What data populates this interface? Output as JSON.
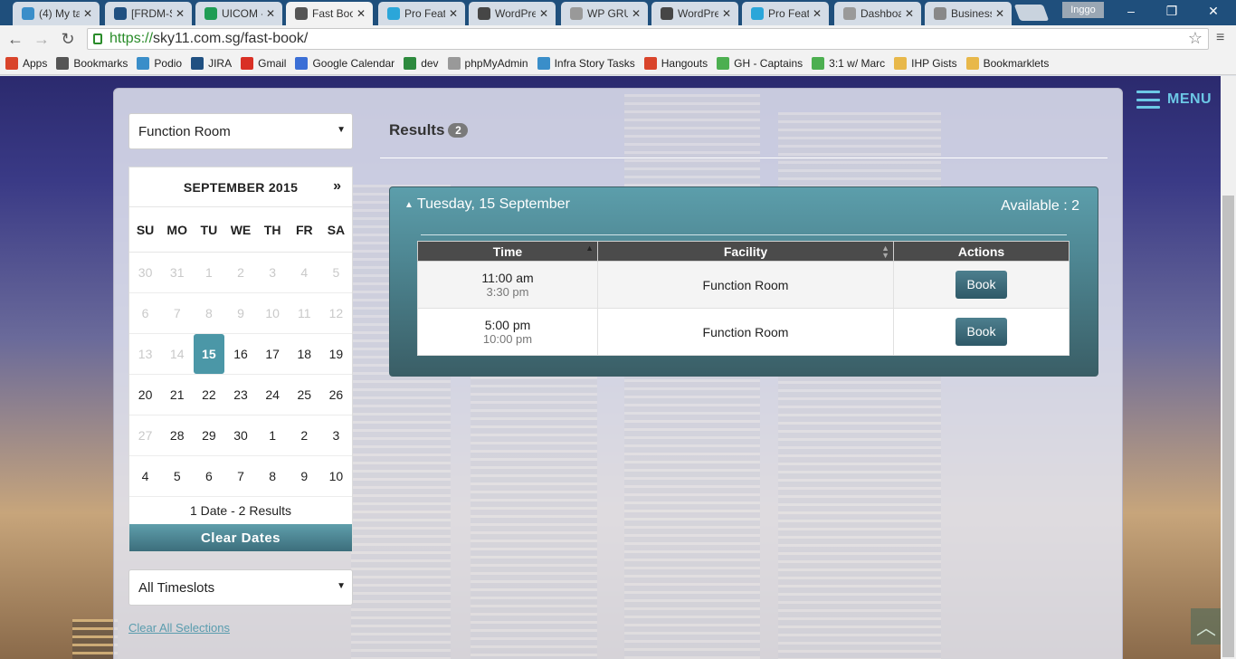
{
  "browser": {
    "tabs": [
      {
        "title": "(4) My ta",
        "icon": "podio-icon",
        "color": "#3a8ec9"
      },
      {
        "title": "[FRDM-S",
        "icon": "jira-icon",
        "color": "#205081"
      },
      {
        "title": "UICOM -",
        "icon": "sheets-icon",
        "color": "#1f9d55"
      },
      {
        "title": "Fast Boo",
        "icon": "site-icon",
        "color": "#555555"
      },
      {
        "title": "Pro Featu",
        "icon": "elementor-icon",
        "color": "#2ba6d9"
      },
      {
        "title": "WordPre",
        "icon": "wordpress-icon",
        "color": "#464646"
      },
      {
        "title": "WP GRU",
        "icon": "page-icon",
        "color": "#999999"
      },
      {
        "title": "WordPre",
        "icon": "wordpress-icon",
        "color": "#464646"
      },
      {
        "title": "Pro Featu",
        "icon": "elementor-icon",
        "color": "#2ba6d9"
      },
      {
        "title": "Dashboa",
        "icon": "page-icon",
        "color": "#999999"
      },
      {
        "title": "Business",
        "icon": "wp-icon",
        "color": "#888888"
      }
    ],
    "user": "Inggo",
    "url_scheme": "https://",
    "url_host_path": "sky11.com.sg/fast-book/",
    "bookmarks": [
      {
        "label": "Apps",
        "icon": "apps-grid-icon",
        "color": "#d9442b"
      },
      {
        "label": "Bookmarks",
        "icon": "star-icon",
        "color": "#555555"
      },
      {
        "label": "Podio",
        "icon": "podio-icon",
        "color": "#3a8ec9"
      },
      {
        "label": "JIRA",
        "icon": "jira-icon",
        "color": "#205081"
      },
      {
        "label": "Gmail",
        "icon": "gmail-icon",
        "color": "#d93025"
      },
      {
        "label": "Google Calendar",
        "icon": "calendar-icon",
        "color": "#3b6fd6"
      },
      {
        "label": "dev",
        "icon": "leaf-icon",
        "color": "#2d8a3e"
      },
      {
        "label": "phpMyAdmin",
        "icon": "page-icon",
        "color": "#999999"
      },
      {
        "label": "Infra Story Tasks",
        "icon": "podio-icon",
        "color": "#3a8ec9"
      },
      {
        "label": "Hangouts",
        "icon": "gplus-icon",
        "color": "#d9442b"
      },
      {
        "label": "GH - Captains",
        "icon": "evernote-icon",
        "color": "#4caf50"
      },
      {
        "label": "3:1 w/ Marc",
        "icon": "evernote-icon",
        "color": "#4caf50"
      },
      {
        "label": "IHP Gists",
        "icon": "folder-icon",
        "color": "#e8b84a"
      },
      {
        "label": "Bookmarklets",
        "icon": "folder-icon",
        "color": "#e8b84a"
      }
    ]
  },
  "site": {
    "menu_label": "MENU",
    "facility_select": "Function Room",
    "timeslot_select": "All Timeslots",
    "clear_all": "Clear All Selections",
    "calendar": {
      "month_label": "SEPTEMBER 2015",
      "next_label": "»",
      "days_of_week": [
        "SU",
        "MO",
        "TU",
        "WE",
        "TH",
        "FR",
        "SA"
      ],
      "weeks": [
        [
          {
            "d": "30",
            "dim": true
          },
          {
            "d": "31",
            "dim": true
          },
          {
            "d": "1",
            "dim": true
          },
          {
            "d": "2",
            "dim": true
          },
          {
            "d": "3",
            "dim": true
          },
          {
            "d": "4",
            "dim": true
          },
          {
            "d": "5",
            "dim": true
          }
        ],
        [
          {
            "d": "6",
            "dim": true
          },
          {
            "d": "7",
            "dim": true
          },
          {
            "d": "8",
            "dim": true
          },
          {
            "d": "9",
            "dim": true
          },
          {
            "d": "10",
            "dim": true
          },
          {
            "d": "11",
            "dim": true
          },
          {
            "d": "12",
            "dim": true
          }
        ],
        [
          {
            "d": "13",
            "dim": true
          },
          {
            "d": "14",
            "dim": true
          },
          {
            "d": "15",
            "sel": true
          },
          {
            "d": "16"
          },
          {
            "d": "17"
          },
          {
            "d": "18"
          },
          {
            "d": "19"
          }
        ],
        [
          {
            "d": "20"
          },
          {
            "d": "21"
          },
          {
            "d": "22"
          },
          {
            "d": "23"
          },
          {
            "d": "24"
          },
          {
            "d": "25"
          },
          {
            "d": "26"
          }
        ],
        [
          {
            "d": "27",
            "dim": true
          },
          {
            "d": "28"
          },
          {
            "d": "29"
          },
          {
            "d": "30"
          },
          {
            "d": "1"
          },
          {
            "d": "2"
          },
          {
            "d": "3"
          }
        ],
        [
          {
            "d": "4"
          },
          {
            "d": "5"
          },
          {
            "d": "6"
          },
          {
            "d": "7"
          },
          {
            "d": "8"
          },
          {
            "d": "9"
          },
          {
            "d": "10"
          }
        ]
      ],
      "summary": "1 Date - 2 Results",
      "clear_label": "Clear Dates"
    },
    "results": {
      "title": "Results",
      "count": "2",
      "day_label": "Tuesday, 15 September",
      "available_label": "Available : 2",
      "columns": [
        "Time",
        "Facility",
        "Actions"
      ],
      "rows": [
        {
          "start": "11:00 am",
          "end": "3:30 pm",
          "facility": "Function Room",
          "action": "Book"
        },
        {
          "start": "5:00 pm",
          "end": "10:00 pm",
          "facility": "Function Room",
          "action": "Book"
        }
      ]
    }
  }
}
